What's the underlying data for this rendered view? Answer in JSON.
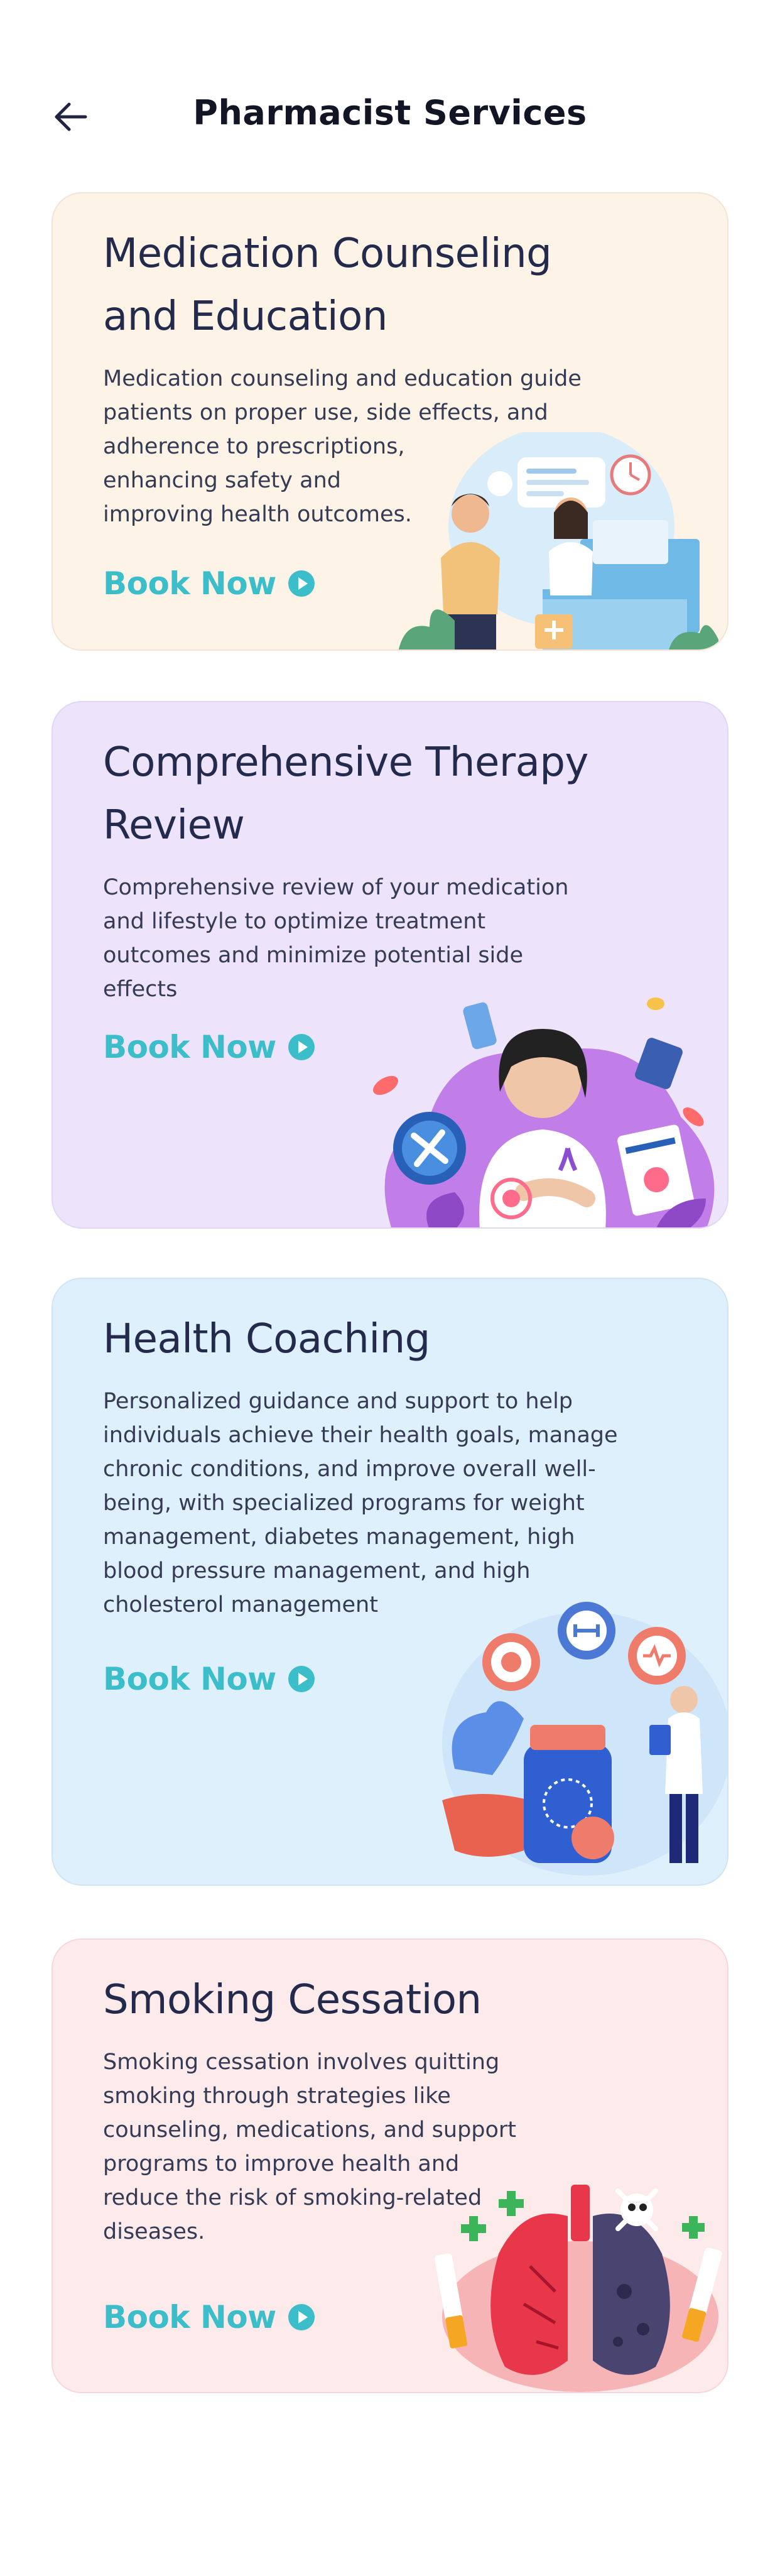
{
  "header": {
    "title": "Pharmacist Services",
    "back_icon": "arrow-left-icon"
  },
  "services": [
    {
      "title_line1": "Medication Counseling",
      "title_line2": "and Education",
      "desc_lines": [
        "Medication counseling and education guide",
        "patients on proper use, side effects, and",
        "adherence to prescriptions,",
        "enhancing safety and",
        "improving health outcomes."
      ],
      "cta": "Book Now",
      "background": "#fdf3e6",
      "illustration": "pharmacist-counter-illustration"
    },
    {
      "title_line1": "Comprehensive Therapy",
      "title_line2": "Review",
      "desc_lines": [
        "Comprehensive review of your medication",
        "and lifestyle to optimize treatment",
        "outcomes and minimize potential side",
        "effects"
      ],
      "cta": "Book Now",
      "background": "#ede3fb",
      "illustration": "arthritis-patient-illustration"
    },
    {
      "title_line1": "Health Coaching",
      "desc_lines": [
        "Personalized guidance and support to help",
        "individuals achieve their health goals, manage",
        "chronic conditions, and improve overall well-",
        "being, with specialized programs for weight",
        "management, diabetes management, high",
        "blood pressure management, and high",
        "cholesterol management"
      ],
      "cta": "Book Now",
      "background": "#dff0fd",
      "illustration": "health-coach-doctor-illustration"
    },
    {
      "title_line1": "Smoking Cessation",
      "desc_lines": [
        "Smoking cessation involves quitting",
        "smoking through strategies like",
        "counseling, medications, and support",
        "programs to improve health and",
        "reduce the risk of smoking-related",
        "diseases."
      ],
      "cta": "Book Now",
      "background": "#fdeaea",
      "illustration": "lungs-smoking-illustration"
    }
  ],
  "colors": {
    "accent": "#3bbec9",
    "title": "#232a4b",
    "text": "#353a55"
  }
}
